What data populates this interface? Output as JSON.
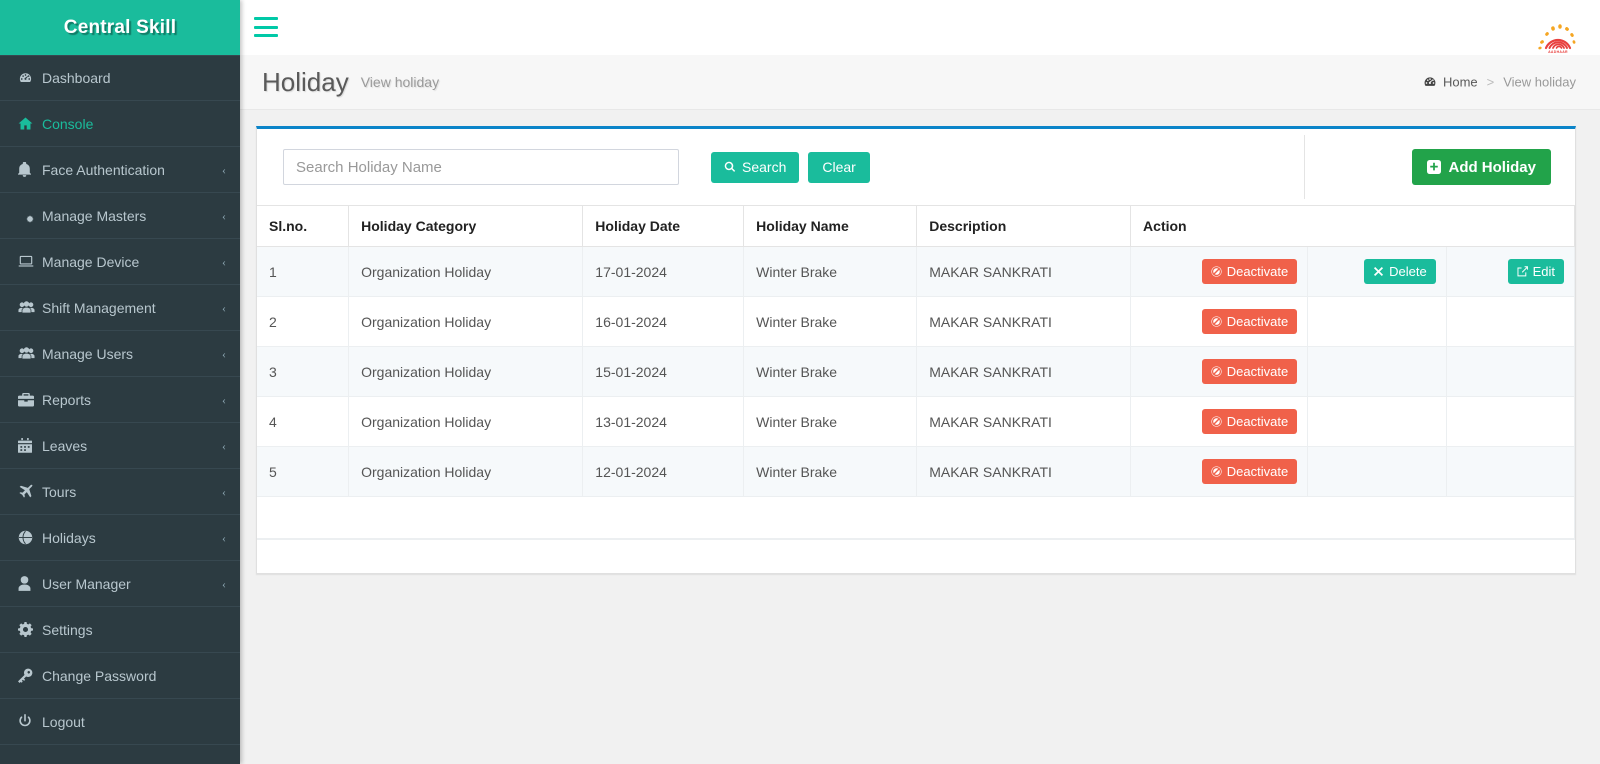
{
  "brand": {
    "title": "Central Skill"
  },
  "sidebar": {
    "items": [
      {
        "label": "Dashboard",
        "icon": "dashboard-icon",
        "arrow": "",
        "active": false
      },
      {
        "label": "Console",
        "icon": "home-icon",
        "arrow": "",
        "active": true
      },
      {
        "label": "Face Authentication",
        "icon": "bell-icon",
        "arrow": "‹",
        "active": false
      },
      {
        "label": "Manage Masters",
        "icon": "gears-icon",
        "arrow": "‹",
        "active": false
      },
      {
        "label": "Manage Device",
        "icon": "laptop-icon",
        "arrow": "‹",
        "active": false
      },
      {
        "label": "Shift Management",
        "icon": "users-group-icon",
        "arrow": "‹",
        "active": false
      },
      {
        "label": "Manage Users",
        "icon": "users-group-icon",
        "arrow": "‹",
        "active": false
      },
      {
        "label": "Reports",
        "icon": "briefcase-icon",
        "arrow": "‹",
        "active": false
      },
      {
        "label": "Leaves",
        "icon": "calendar-icon",
        "arrow": "‹",
        "active": false
      },
      {
        "label": "Tours",
        "icon": "plane-icon",
        "arrow": "‹",
        "active": false
      },
      {
        "label": "Holidays",
        "icon": "globe-icon",
        "arrow": "‹",
        "active": false
      },
      {
        "label": "User Manager",
        "icon": "user-icon",
        "arrow": "‹",
        "active": false
      },
      {
        "label": "Settings",
        "icon": "gear-icon",
        "arrow": "",
        "active": false
      },
      {
        "label": "Change Password",
        "icon": "key-icon",
        "arrow": "",
        "active": false
      },
      {
        "label": "Logout",
        "icon": "power-icon",
        "arrow": "",
        "active": false
      }
    ]
  },
  "topbar": {
    "menu_toggle": "hamburger-icon",
    "logo_alt": "AADHAAR"
  },
  "header": {
    "title": "Holiday",
    "subtitle": "View holiday",
    "breadcrumb": {
      "home": "Home",
      "separator": ">",
      "current": "View holiday"
    }
  },
  "toolbar": {
    "search_placeholder": "Search Holiday Name",
    "search_value": "",
    "search_label": "Search",
    "clear_label": "Clear",
    "add_label": "Add Holiday"
  },
  "table": {
    "columns": [
      "Sl.no.",
      "Holiday Category",
      "Holiday Date",
      "Holiday Name",
      "Description",
      "Action"
    ],
    "rows": [
      {
        "sl": "1",
        "category": "Organization Holiday",
        "date": "17-01-2024",
        "name": "Winter Brake",
        "description": "MAKAR SANKRATI",
        "deactivate": "Deactivate",
        "delete": "Delete",
        "edit": "Edit"
      },
      {
        "sl": "2",
        "category": "Organization Holiday",
        "date": "16-01-2024",
        "name": "Winter Brake",
        "description": "MAKAR SANKRATI",
        "deactivate": "Deactivate",
        "delete": "",
        "edit": ""
      },
      {
        "sl": "3",
        "category": "Organization Holiday",
        "date": "15-01-2024",
        "name": "Winter Brake",
        "description": "MAKAR SANKRATI",
        "deactivate": "Deactivate",
        "delete": "",
        "edit": ""
      },
      {
        "sl": "4",
        "category": "Organization Holiday",
        "date": "13-01-2024",
        "name": "Winter Brake",
        "description": "MAKAR SANKRATI",
        "deactivate": "Deactivate",
        "delete": "",
        "edit": ""
      },
      {
        "sl": "5",
        "category": "Organization Holiday",
        "date": "12-01-2024",
        "name": "Winter Brake",
        "description": "MAKAR SANKRATI",
        "deactivate": "Deactivate",
        "delete": "",
        "edit": ""
      }
    ]
  },
  "colors": {
    "brand_green": "#1abc9c",
    "sidebar_dark": "#2c3b41",
    "panel_top_border": "#0b84c9",
    "danger_red": "#f0614a",
    "add_green": "#22a34a"
  }
}
